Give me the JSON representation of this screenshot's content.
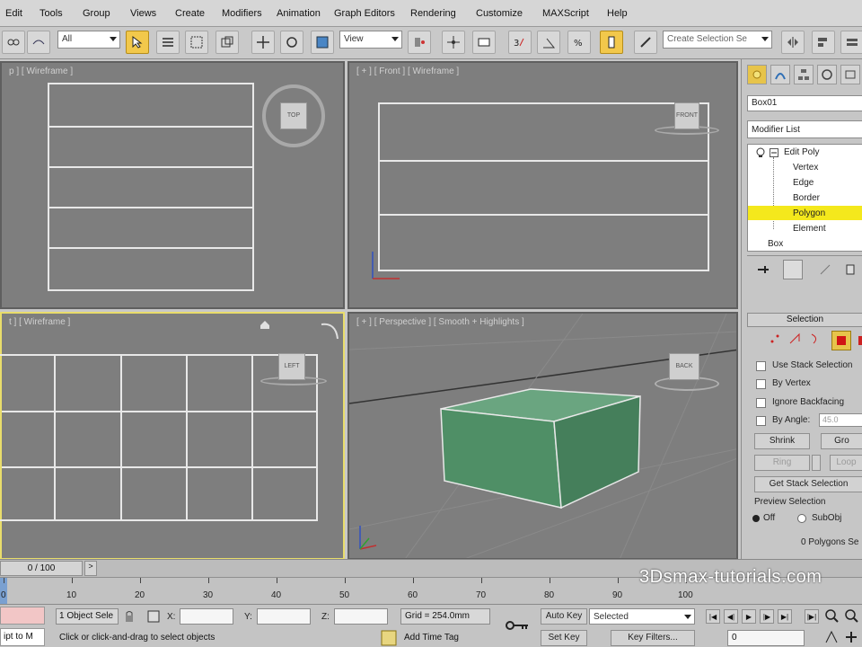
{
  "menu": [
    "Edit",
    "Tools",
    "Group",
    "Views",
    "Create",
    "Modifiers",
    "Animation",
    "Graph Editors",
    "Rendering",
    "Customize",
    "MAXScript",
    "Help"
  ],
  "toolbar": {
    "filter_value": "All",
    "ref_coord_value": "View",
    "selection_set_placeholder": "Create Selection Se"
  },
  "viewports": {
    "top_label": "p ] [ Wireframe ]",
    "front_label": "[ + ] [ Front ] [ Wireframe ]",
    "left_label": "t ] [ Wireframe ]",
    "persp_label": "[ + ] [ Perspective ] [ Smooth + Highlights ]",
    "top_cube": "TOP",
    "front_cube": "FRONT",
    "left_cube": "LEFT",
    "persp_cube": "BACK"
  },
  "panel": {
    "object_name": "Box01",
    "modifier_list": "Modifier List",
    "stack": {
      "root": "Edit Poly",
      "items": [
        "Vertex",
        "Edge",
        "Border",
        "Polygon",
        "Element"
      ],
      "selected": "Polygon",
      "base": "Box"
    },
    "selection_rollout": "Selection",
    "options": [
      "Use Stack Selection",
      "By Vertex",
      "Ignore Backfacing",
      "By Angle:"
    ],
    "angle_value": "45.0",
    "buttons": {
      "shrink": "Shrink",
      "grow": "Gro",
      "ring": "Ring",
      "loop": "Loop",
      "get_stack": "Get Stack Selection"
    },
    "preview_title": "Preview Selection",
    "preview_off": "Off",
    "preview_subobj": "SubObj",
    "polygons_selected": "0 Polygons Se"
  },
  "timeline": {
    "frame_counter": "0 / 100",
    "ticks": [
      "0",
      "10",
      "20",
      "30",
      "40",
      "50",
      "60",
      "70",
      "80",
      "90",
      "100"
    ]
  },
  "status": {
    "maxscript_text": "ipt to M",
    "selected_objects": "1 Object Sele",
    "x_label": "X:",
    "y_label": "Y:",
    "z_label": "Z:",
    "grid": "Grid = 254.0mm",
    "auto_key": "Auto Key",
    "set_key": "Set Key",
    "key_mode": "Selected",
    "key_filters": "Key Filters...",
    "frame_field": "0",
    "prompt": "Click or click-and-drag to select objects",
    "add_time_tag": "Add Time Tag"
  },
  "watermark": "3Dsmax-tutorials.com",
  "colors": {
    "box_green": "#4f8f66",
    "selected_stack": "#f4e81c",
    "active_border": "#e9dd6b",
    "viewport_bg": "#7e7e7e"
  }
}
